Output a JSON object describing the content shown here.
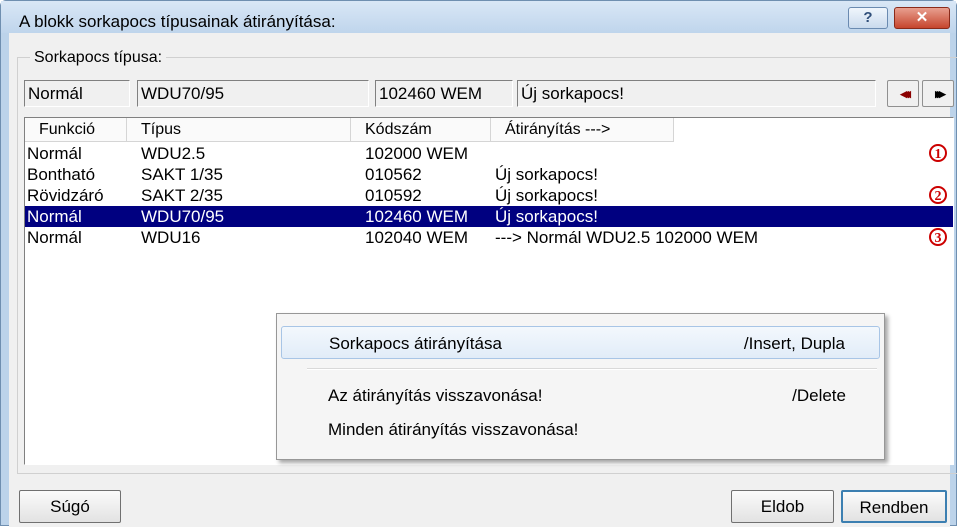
{
  "window": {
    "title": "A blokk sorkapocs típusainak átirányítása:",
    "help_glyph": "?",
    "close_glyph": "✕"
  },
  "group": {
    "label": "Sorkapocs típusa:",
    "fields": [
      "Normál",
      "WDU70/95",
      "102460 WEM",
      "Új sorkapocs!"
    ],
    "nav_prev_glyph": "◀◀◀",
    "nav_next_glyph": "▶▶▶"
  },
  "list": {
    "columns": [
      "Funkció",
      "Típus",
      "Kódszám",
      "Átirányítás --->"
    ],
    "rows": [
      {
        "funkcio": "Normál",
        "tipus": "WDU2.5",
        "kod": "102000 WEM",
        "atir": "",
        "badge": "1"
      },
      {
        "funkcio": "Bontható",
        "tipus": "SAKT 1/35",
        "kod": "010562",
        "atir": "Új sorkapocs!",
        "badge": ""
      },
      {
        "funkcio": "Rövidzáró",
        "tipus": "SAKT 2/35",
        "kod": "010592",
        "atir": "Új sorkapocs!",
        "badge": "2"
      },
      {
        "funkcio": "Normál",
        "tipus": "WDU70/95",
        "kod": "102460 WEM",
        "atir": "Új sorkapocs!",
        "badge": "",
        "selected": true
      },
      {
        "funkcio": "Normál",
        "tipus": "WDU16",
        "kod": "102040 WEM",
        "atir": "---> Normál  WDU2.5   102000 WEM",
        "badge": "3"
      }
    ]
  },
  "context_menu": {
    "items": [
      {
        "label": "Sorkapocs átirányítása",
        "shortcut": "/Insert, Dupla"
      },
      {
        "label": "Az átirányítás visszavonása!",
        "shortcut": "/Delete"
      },
      {
        "label": "Minden átirányítás visszavonása!",
        "shortcut": ""
      }
    ]
  },
  "buttons": {
    "help": "Súgó",
    "discard": "Eldob",
    "ok": "Rendben"
  },
  "colors": {
    "selection": "#000080",
    "badge": "#cc0000",
    "nav_arrows": "#8b0000"
  }
}
